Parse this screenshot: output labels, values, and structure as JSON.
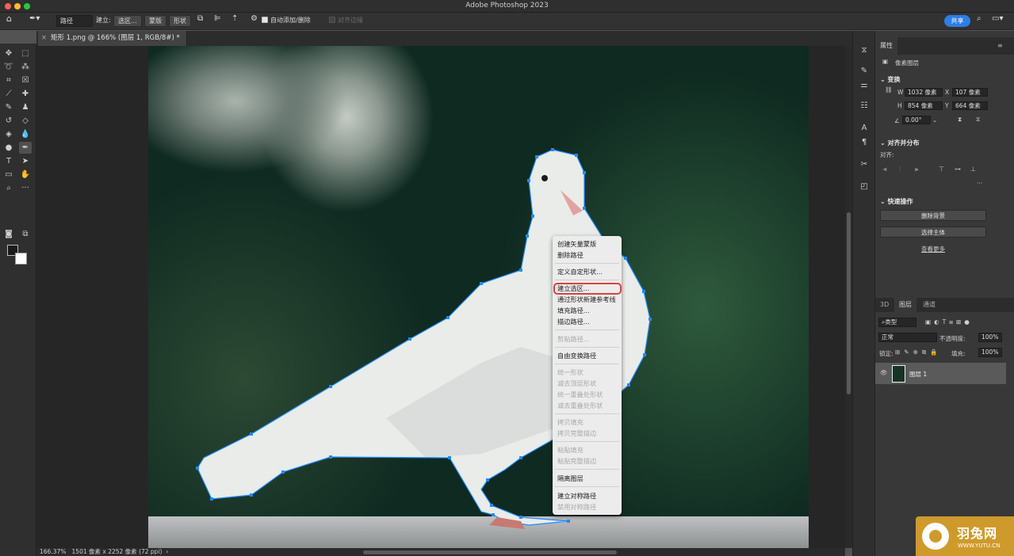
{
  "window": {
    "title": "Adobe Photoshop 2023"
  },
  "options_bar": {
    "mode_select": "路径",
    "make_label": "建立:",
    "selection_button": "选区...",
    "mask_button": "蒙版",
    "shape_button": "形状",
    "auto_add_delete": "自动添加/删除",
    "align_edges": "对齐边缘",
    "share_button": "共享"
  },
  "document": {
    "tab_title": "矩形 1.png @ 166% (图层 1, RGB/8#) *"
  },
  "status_bar": {
    "zoom": "166.37%",
    "doc_info": "1501 像素 x 2252 像素 (72 ppi)"
  },
  "context_menu": {
    "items": [
      {
        "label": "创建矢量蒙版",
        "enabled": true
      },
      {
        "label": "删除路径",
        "enabled": true
      },
      {
        "label": "定义自定形状...",
        "enabled": true
      },
      {
        "label": "建立选区...",
        "enabled": true,
        "highlighted": true
      },
      {
        "label": "通过形状新建参考线",
        "enabled": true
      },
      {
        "label": "填充路径...",
        "enabled": true
      },
      {
        "label": "描边路径...",
        "enabled": true
      },
      {
        "label": "剪贴路径...",
        "enabled": false
      },
      {
        "label": "自由变换路径",
        "enabled": true
      },
      {
        "label": "统一形状",
        "enabled": false
      },
      {
        "label": "减去顶层形状",
        "enabled": false
      },
      {
        "label": "统一重叠处形状",
        "enabled": false
      },
      {
        "label": "减去重叠处形状",
        "enabled": false
      },
      {
        "label": "拷贝填充",
        "enabled": false
      },
      {
        "label": "拷贝完整描边",
        "enabled": false
      },
      {
        "label": "粘贴填充",
        "enabled": false
      },
      {
        "label": "粘贴完整描边",
        "enabled": false
      },
      {
        "label": "隔离图层",
        "enabled": true
      },
      {
        "label": "建立对称路径",
        "enabled": true
      },
      {
        "label": "禁用对称路径",
        "enabled": false
      }
    ]
  },
  "properties_panel": {
    "tab": "属性",
    "layer_type": "像素图层",
    "transform": {
      "title": "变换",
      "w_label": "W",
      "w": "1032 像素",
      "x_label": "X",
      "x": "107 像素",
      "h_label": "H",
      "h": "854 像素",
      "y_label": "Y",
      "y": "664 像素",
      "angle": "0.00°"
    },
    "align": {
      "title": "对齐并分布",
      "label": "对齐:"
    },
    "quick_actions": {
      "title": "快速操作",
      "remove_bg": "删除背景",
      "select_subject": "选择主体",
      "see_more": "查看更多"
    }
  },
  "layers_panel": {
    "tabs": [
      "3D",
      "图层",
      "通道"
    ],
    "filter": "类型",
    "blend_mode": "正常",
    "opacity_label": "不透明度:",
    "opacity": "100%",
    "lock_label": "锁定:",
    "fill_label": "填充:",
    "fill": "100%",
    "layers": [
      {
        "name": "图层 1",
        "visible": true
      }
    ]
  },
  "watermark": {
    "cn": "羽兔网",
    "en": "WWW.YUTU.CN"
  }
}
